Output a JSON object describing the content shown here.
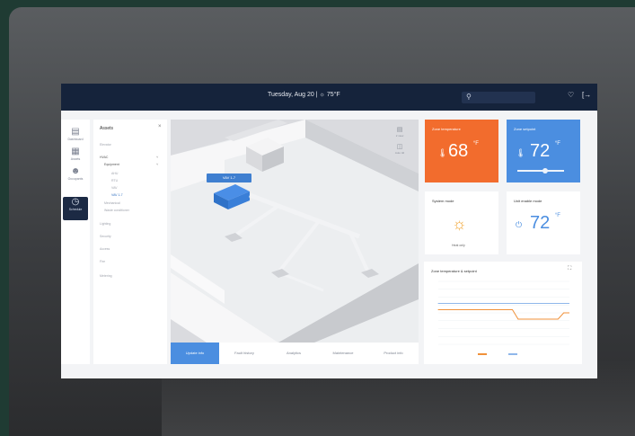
{
  "topbar": {
    "date": "Tuesday, Aug 20 | ☼ 75°F",
    "search_icon": "search-icon",
    "bell_icon": "bell-icon",
    "logout_icon": "logout-icon"
  },
  "rail": {
    "items": [
      {
        "icon": "home-icon",
        "label": "Dashboard"
      },
      {
        "icon": "building-icon",
        "label": "Assets"
      },
      {
        "icon": "user-icon",
        "label": "Occupants"
      },
      {
        "icon": "clock-icon",
        "label": "Schedule"
      }
    ]
  },
  "assets": {
    "title": "Assets",
    "items": [
      "Elevator",
      "HVAC",
      "Equipment",
      "AHU",
      "RTU",
      "VAV",
      "VAV 1-7",
      "Mechanical",
      "Waste conditioner",
      "Lighting",
      "Security",
      "Access",
      "Fire",
      "Metering"
    ]
  },
  "view": {
    "tag": "VAV 1-7",
    "icons": [
      {
        "icon": "layers-icon",
        "label": "2 view"
      },
      {
        "icon": "cube-icon",
        "label": "Auto 3d"
      }
    ],
    "tabs": [
      "Update info",
      "Fault history",
      "Analytics",
      "Maintenance",
      "Product info"
    ],
    "active_tab": 0
  },
  "tiles": {
    "zone_temperature": {
      "title": "Zone temperature",
      "value": "68",
      "unit": "°F",
      "color": "#f26c2d"
    },
    "zone_setpoint": {
      "title": "Zone setpoint",
      "value": "72",
      "unit": "°F",
      "color": "#4b8ee0",
      "slider": 0.6
    },
    "system_mode": {
      "title": "System mode",
      "mode": "Heat only"
    },
    "unit_enable_mode": {
      "title": "Unit enable mode",
      "value": "72",
      "unit": "°F"
    }
  },
  "chart": {
    "title": "Zone temperature & setpoint"
  },
  "chart_data": {
    "type": "line",
    "title": "Zone temperature & setpoint",
    "x": [
      0,
      1,
      2,
      3,
      4,
      5,
      6,
      7,
      8,
      9,
      10,
      11,
      12,
      13,
      14,
      15,
      16,
      17,
      18,
      19,
      20,
      21,
      22,
      23
    ],
    "series": [
      {
        "color": "#f0913a",
        "values": [
          71,
          71,
          71,
          71,
          71,
          71,
          71,
          71,
          71,
          71,
          71,
          71,
          71,
          71,
          68,
          68,
          68,
          68,
          68,
          68,
          68,
          68,
          70,
          70
        ]
      },
      {
        "color": "#8fb7ea",
        "values": [
          73,
          73,
          73,
          73,
          73,
          73,
          73,
          73,
          73,
          73,
          73,
          73,
          73,
          73,
          73,
          73,
          73,
          73,
          73,
          73,
          73,
          73,
          73,
          73
        ]
      }
    ],
    "ylim": [
      60,
      80
    ],
    "grid": true,
    "legend": "bottom"
  }
}
